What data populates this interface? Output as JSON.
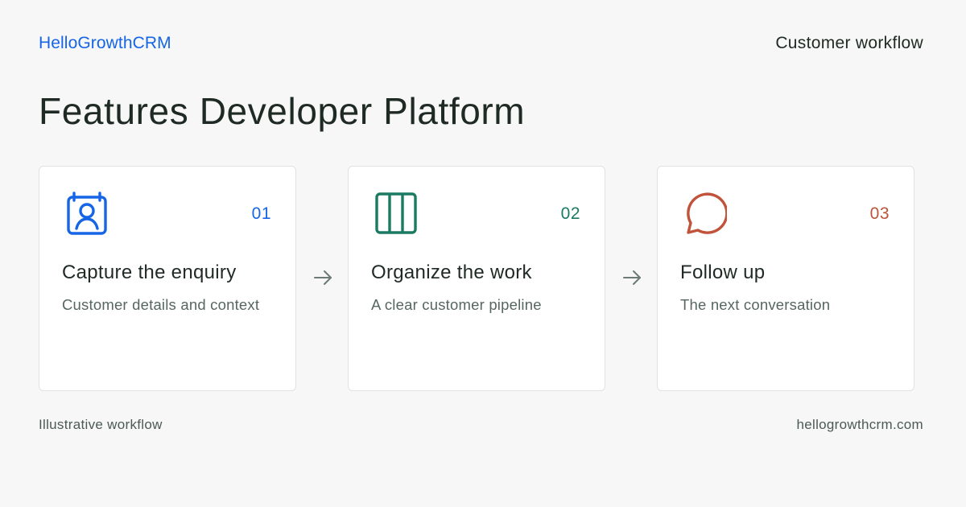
{
  "header": {
    "brand": "HelloGrowthCRM",
    "section_label": "Customer workflow"
  },
  "title": "Features Developer Platform",
  "steps": [
    {
      "number": "01",
      "title": "Capture the enquiry",
      "description": "Customer details and context",
      "icon": "contact-card-icon",
      "color": "#1565e6"
    },
    {
      "number": "02",
      "title": "Organize the work",
      "description": "A clear customer pipeline",
      "icon": "columns-icon",
      "color": "#1b7a62"
    },
    {
      "number": "03",
      "title": "Follow up",
      "description": "The next conversation",
      "icon": "chat-bubble-icon",
      "color": "#c0533a"
    }
  ],
  "footer": {
    "note": "Illustrative workflow",
    "site": "hellogrowthcrm.com"
  },
  "colors": {
    "background": "#f6f7f6",
    "text": "#1f2a24",
    "muted_text": "#566660",
    "card_border": "#dfe3e1",
    "arrow": "#6d7a75"
  }
}
